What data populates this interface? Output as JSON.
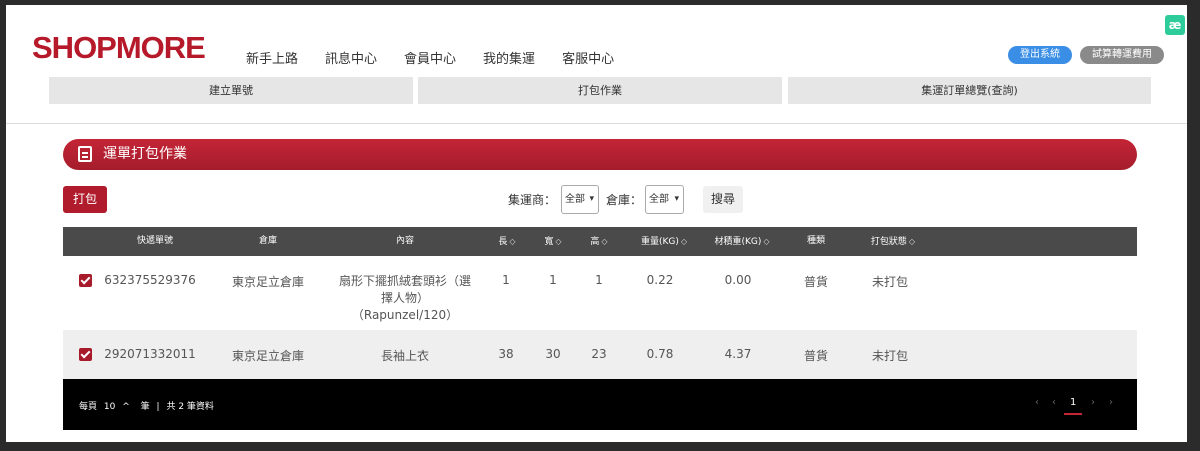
{
  "header": {
    "logo": "SHOPMORE",
    "nav": [
      "新手上路",
      "訊息中心",
      "會員中心",
      "我的集運",
      "客服中心"
    ],
    "logout_label": "登出系統",
    "trial_label": "試算轉運費用",
    "ext_icon_glyph": "æ"
  },
  "subnav": [
    "建立單號",
    "打包作業",
    "集運訂單總覽(查詢)"
  ],
  "banner": {
    "title": "運單打包作業"
  },
  "toolbar": {
    "pack_label": "打包",
    "carrier_label": "集運商：",
    "carrier_value": "全部",
    "warehouse_label": "倉庫：",
    "warehouse_value": "全部",
    "search_label": "搜尋"
  },
  "table": {
    "columns": [
      "快遞單號",
      "倉庫",
      "內容",
      "長",
      "寬",
      "高",
      "重量(KG)",
      "材積重(KG)",
      "種類",
      "打包狀態"
    ],
    "rows": [
      {
        "tracking": "632375529376",
        "warehouse": "東京足立倉庫",
        "content": "扇形下擺抓絨套頭衫（選擇人物）（Rapunzel/120）",
        "length": "1",
        "width": "1",
        "height": "1",
        "weight": "0.22",
        "vol_weight": "0.00",
        "type": "普貨",
        "status": "未打包",
        "checked": true
      },
      {
        "tracking": "292071332011",
        "warehouse": "東京足立倉庫",
        "content": "長袖上衣",
        "length": "38",
        "width": "30",
        "height": "23",
        "weight": "0.78",
        "vol_weight": "4.37",
        "type": "普貨",
        "status": "未打包",
        "checked": true
      }
    ]
  },
  "footer": {
    "per_page_label": "每頁",
    "per_page_value": "10",
    "per_page_unit": "筆",
    "separator": "|",
    "total_label": "共 2 筆資料",
    "current_page": "1"
  },
  "colors": {
    "brand": "#b5192a",
    "logout": "#3a8ee6",
    "header_bg": "#4a4a4a"
  }
}
